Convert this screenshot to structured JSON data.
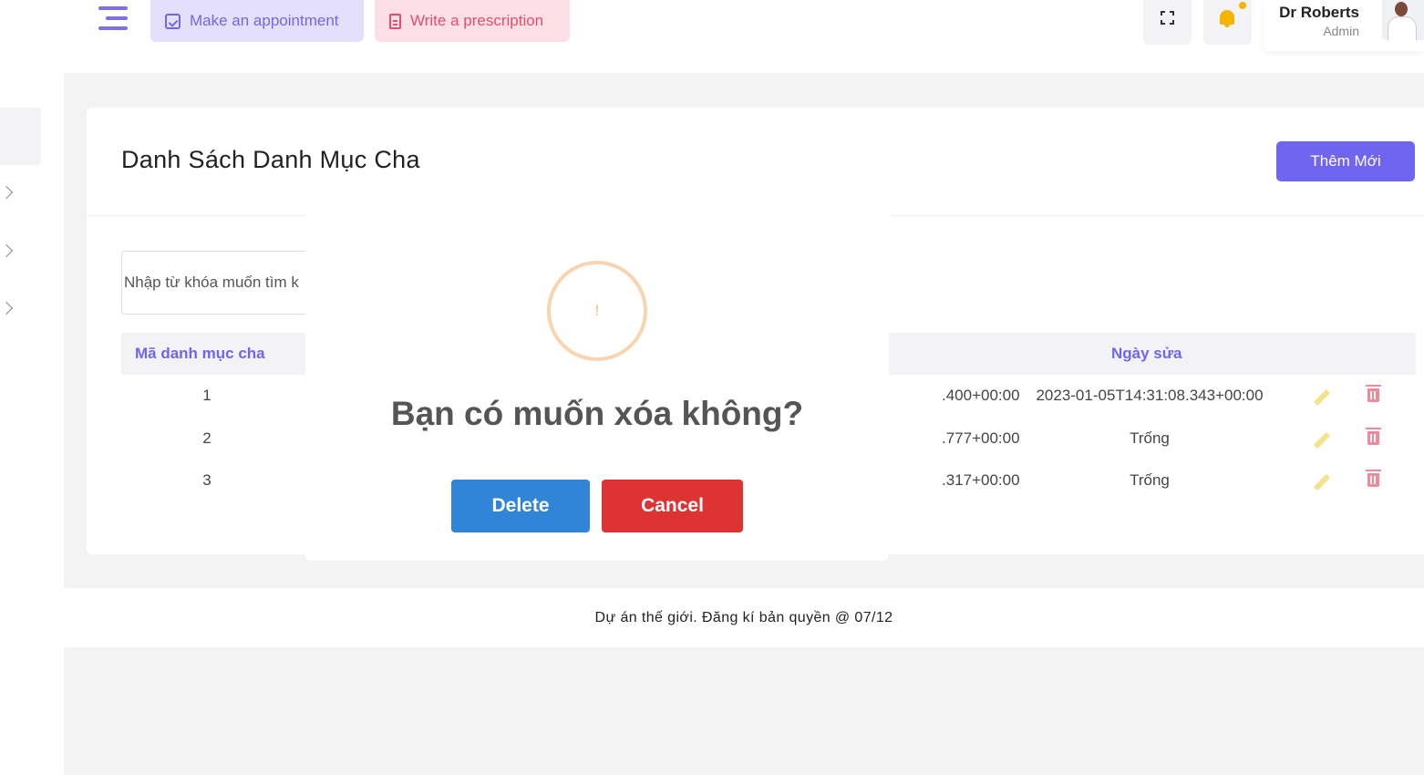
{
  "header": {
    "appointment_label": "Make an appointment",
    "prescription_label": "Write a prescription",
    "user_name": "Dr Roberts",
    "user_role": "Admin"
  },
  "page": {
    "title": "Danh Sách Danh Mục Cha",
    "add_button": "Thêm Mới",
    "search_placeholder": "Nhập từ khóa muốn tìm k"
  },
  "table": {
    "headers": {
      "code": "Mã danh mục cha",
      "modified": "Ngày sửa"
    },
    "rows": [
      {
        "code": "1",
        "created_fragment": ".400+00:00",
        "modified": "2023-01-05T14:31:08.343+00:00"
      },
      {
        "code": "2",
        "created_fragment": ".777+00:00",
        "modified": "Trống"
      },
      {
        "code": "3",
        "created_fragment": ".317+00:00",
        "modified": "Trống"
      }
    ]
  },
  "modal": {
    "icon_text": "!",
    "title": "Bạn có muốn xóa không?",
    "delete_label": "Delete",
    "cancel_label": "Cancel"
  },
  "footer": {
    "text": "Dự án thế giới. Đăng kí bản quyền @ 07/12"
  },
  "colors": {
    "accent": "#7065f0",
    "delete": "#3085d6",
    "cancel": "#dd3333",
    "warning_ring": "#f8d5b0"
  }
}
